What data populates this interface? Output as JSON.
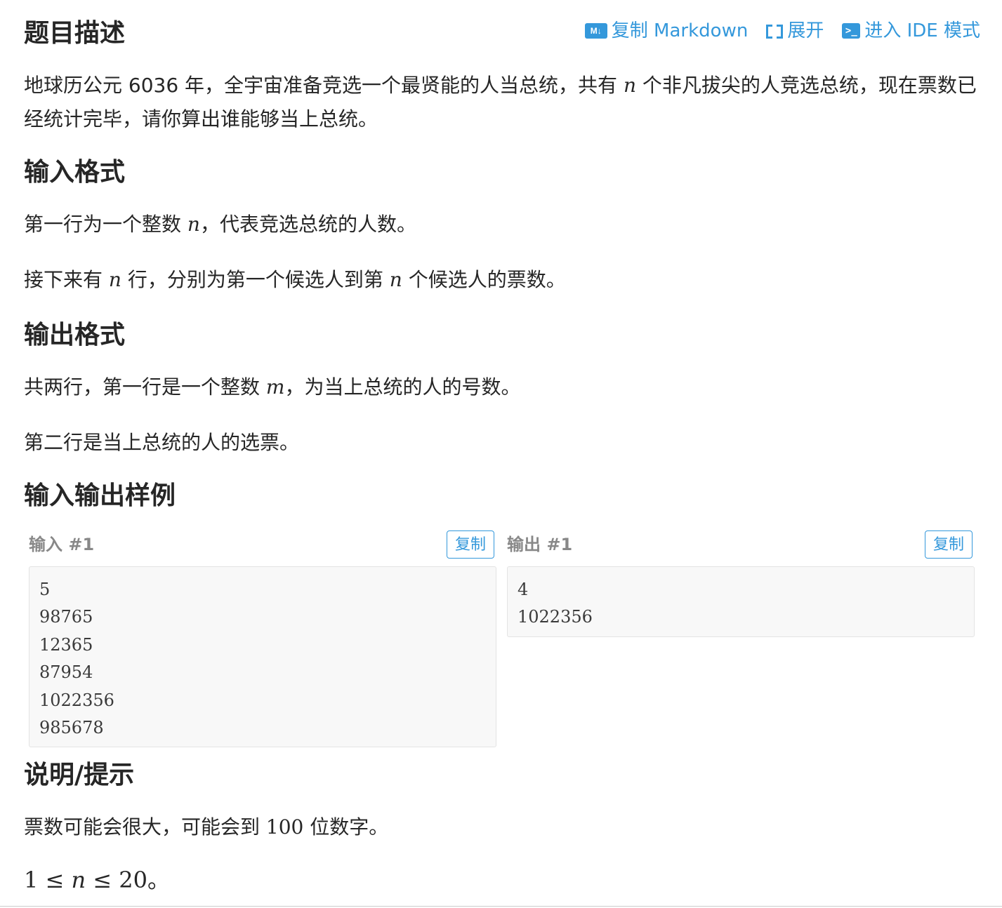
{
  "toolbar": {
    "md_icon": "M↓",
    "copy_markdown": "复制 Markdown",
    "expand": "展开",
    "ide_icon": ">_",
    "ide_mode": "进入 IDE 模式"
  },
  "sections": {
    "description": {
      "title": "题目描述",
      "para1_a": "地球历公元 6036 年，全宇宙准备竞选一个最贤能的人当总统，共有 ",
      "para1_var": "n",
      "para1_b": " 个非凡拔尖的人竞选总统，现在票数已经统计完毕，请你算出谁能够当上总统。"
    },
    "input_format": {
      "title": "输入格式",
      "line1_a": "第一行为一个整数 ",
      "line1_var": "n",
      "line1_b": "，代表竞选总统的人数。",
      "line2_a": "接下来有 ",
      "line2_var1": "n",
      "line2_b": " 行，分别为第一个候选人到第 ",
      "line2_var2": "n",
      "line2_c": " 个候选人的票数。"
    },
    "output_format": {
      "title": "输出格式",
      "line1_a": "共两行，第一行是一个整数 ",
      "line1_var": "m",
      "line1_b": "，为当上总统的人的号数。",
      "line2": "第二行是当上总统的人的选票。"
    },
    "samples": {
      "title": "输入输出样例",
      "input_label": "输入 #1",
      "output_label": "输出 #1",
      "copy_label": "复制",
      "input_lines": [
        "5",
        "98765",
        "12365",
        "87954",
        "1022356",
        "985678"
      ],
      "output_lines": [
        "4",
        "1022356"
      ]
    },
    "hint": {
      "title": "说明/提示",
      "line1_a": "票数可能会很大，可能会到 ",
      "line1_num": "100",
      "line1_b": " 位数字。",
      "constraint_1": "1",
      "constraint_le1": " ≤ ",
      "constraint_n": "n",
      "constraint_le2": " ≤ ",
      "constraint_20": "20",
      "constraint_end": "。"
    }
  }
}
